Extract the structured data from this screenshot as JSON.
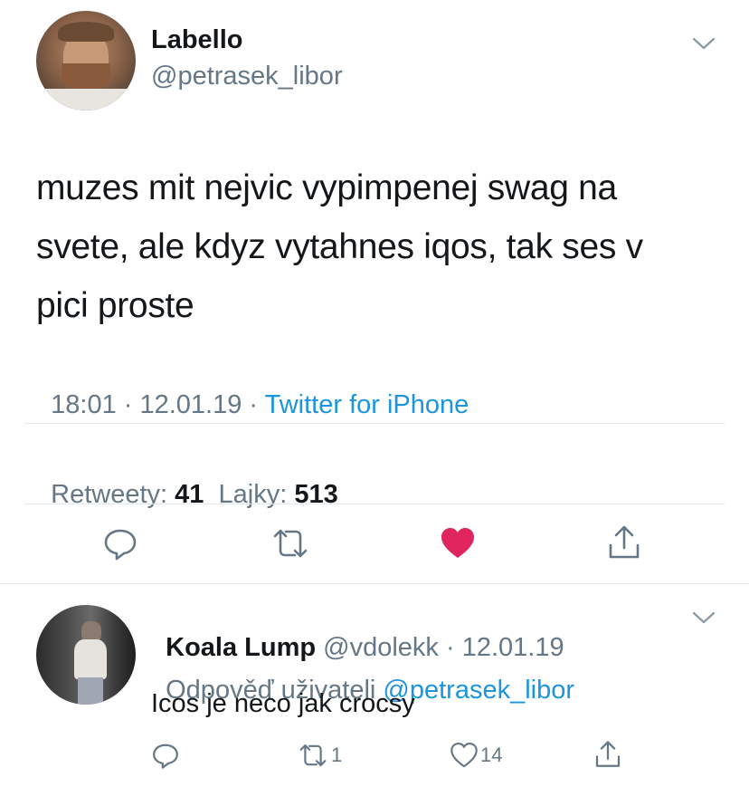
{
  "tweet": {
    "author_name": "Labello",
    "author_handle": "@petrasek_libor",
    "text_line1": "muzes mit nejvic vypimpenej swag na",
    "text_line2": "svete, ale kdyz vytahnes iqos, tak ses v",
    "text_line3": "pici proste",
    "time": "18:01",
    "sep1": " · ",
    "date": "12.01.19",
    "sep2": " · ",
    "source": "Twitter for iPhone",
    "retweets_label": "Retweety:",
    "retweets_count": "41",
    "likes_label": "Lajky:",
    "likes_count": "513",
    "liked": true
  },
  "reply": {
    "author_name": "Koala Lump",
    "author_handle": "@vdolekk",
    "sep": " · ",
    "date": "12.01.19",
    "replying_label": "Odpověď uživateli",
    "replying_handle": "@petrasek_libor",
    "text": "Icos je neco jak crocsy",
    "retweet_count": "1",
    "like_count": "14"
  },
  "colors": {
    "accent_blue": "#1b95e0",
    "like_red": "#e0245e",
    "secondary_gray": "#657786",
    "icon_gray": "#657786"
  },
  "icons": [
    "chevron-down-icon",
    "reply-icon",
    "retweet-icon",
    "heart-filled-icon",
    "heart-outline-icon",
    "share-icon"
  ]
}
